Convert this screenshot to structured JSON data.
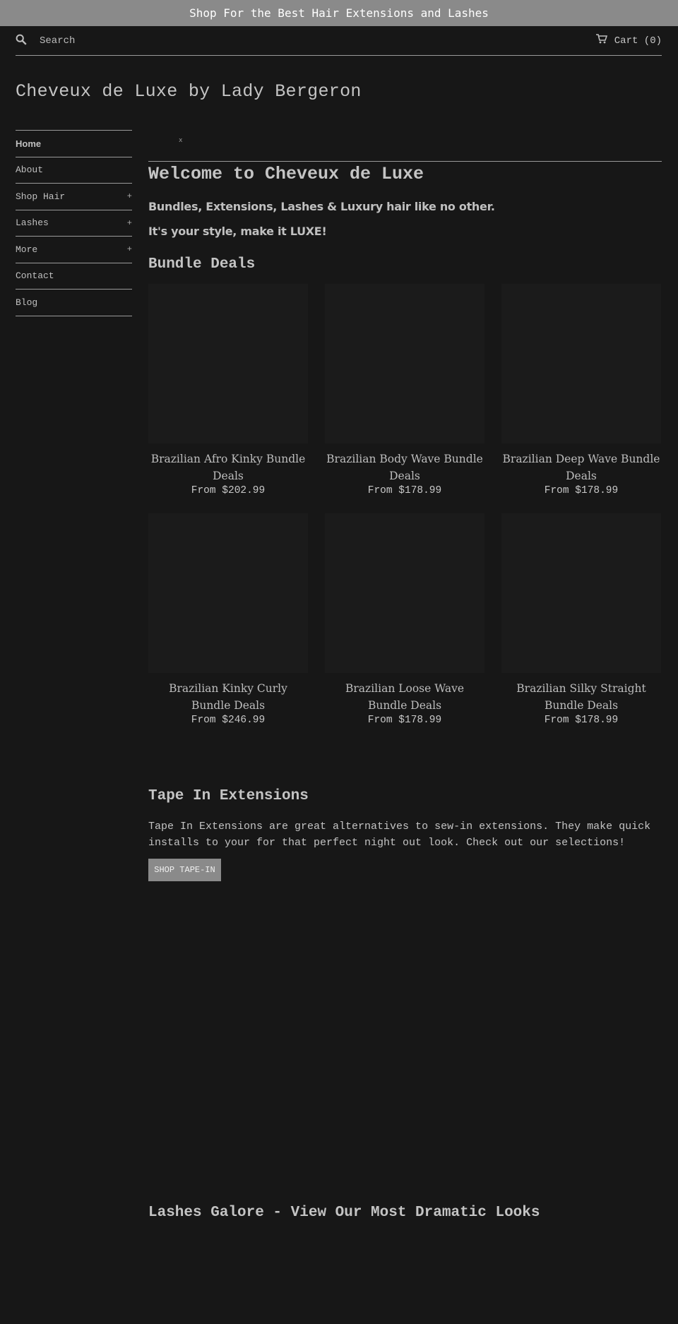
{
  "announcement": {
    "text": "Shop For the Best Hair Extensions and Lashes"
  },
  "header": {
    "search_placeholder": "Search",
    "cart_label": "Cart (0)",
    "site_title": "Cheveux de Luxe by Lady Bergeron"
  },
  "sidebar": {
    "items": [
      {
        "label": "Home",
        "plus": ""
      },
      {
        "label": "About",
        "plus": ""
      },
      {
        "label": "Shop Hair",
        "plus": "+"
      },
      {
        "label": "Lashes",
        "plus": "+"
      },
      {
        "label": "More",
        "plus": "+"
      },
      {
        "label": "Contact",
        "plus": ""
      },
      {
        "label": "Blog",
        "plus": ""
      }
    ]
  },
  "main": {
    "broken_image_glyph": "x",
    "welcome": "Welcome to Cheveux de Luxe",
    "tagline1": "Bundles, Extensions, Lashes & Luxury hair like no other.",
    "tagline2": "It's your style, make it LUXE!",
    "bundle_title": "Bundle Deals",
    "products": [
      {
        "name": "Brazilian Afro Kinky Bundle Deals",
        "price": "From $202.99"
      },
      {
        "name": "Brazilian Body Wave Bundle Deals",
        "price": "From $178.99"
      },
      {
        "name": "Brazilian Deep Wave Bundle Deals",
        "price": "From $178.99"
      },
      {
        "name": "Brazilian Kinky Curly Bundle Deals",
        "price": "From $246.99"
      },
      {
        "name": "Brazilian Loose Wave Bundle Deals",
        "price": "From $178.99"
      },
      {
        "name": "Brazilian Silky Straight Bundle Deals",
        "price": "From $178.99"
      }
    ],
    "tape_title": "Tape In Extensions",
    "tape_text": "Tape In Extensions are great alternatives to sew-in extensions. They make quick installs to your for that perfect night out look. Check out our selections!",
    "tape_button": "SHOP TAPE-IN",
    "lashes_title": "Lashes Galore - View Our Most Dramatic Looks"
  },
  "colors": {
    "background": "#171717",
    "announcement_bar": "#8a8a8a",
    "button": "#8a8a8a",
    "text": "#bdbdbd"
  },
  "icons": [
    "search-icon",
    "cart-icon"
  ]
}
